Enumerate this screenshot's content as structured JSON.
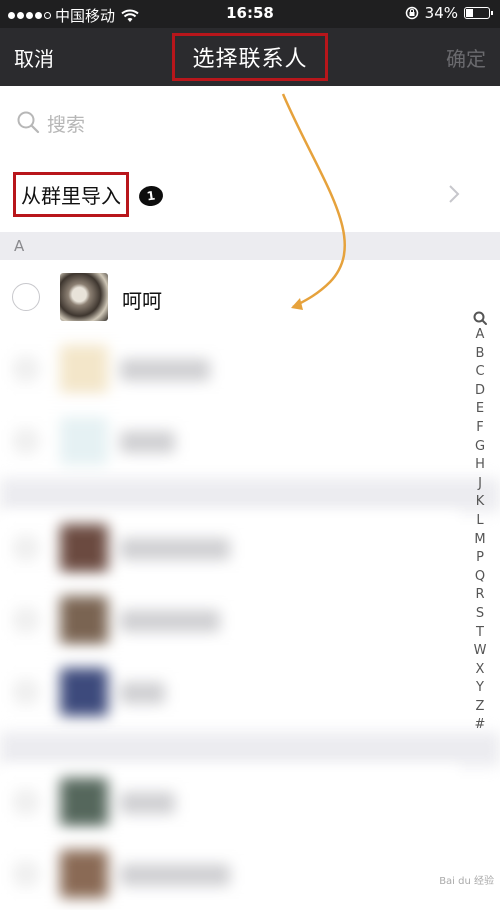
{
  "status_bar": {
    "carrier": "中国移动",
    "time": "16:58",
    "battery": "34%",
    "battery_level": 0.34
  },
  "nav": {
    "cancel_label": "取消",
    "title": "选择联系人",
    "confirm_label": "确定"
  },
  "search": {
    "placeholder": "搜索"
  },
  "import_group": {
    "label": "从群里导入",
    "step_number": "1"
  },
  "sections": [
    {
      "header": "A",
      "contacts": [
        {
          "name": "呵呵"
        }
      ]
    }
  ],
  "index_letters": [
    "A",
    "B",
    "C",
    "D",
    "E",
    "F",
    "G",
    "H",
    "J",
    "K",
    "L",
    "M",
    "P",
    "Q",
    "R",
    "S",
    "T",
    "W",
    "X",
    "Y",
    "Z",
    "#"
  ],
  "colors": {
    "nav_background": "#2b2b2e",
    "highlight_box": "#b8161b",
    "annotation_arrow": "#e6a23c"
  }
}
